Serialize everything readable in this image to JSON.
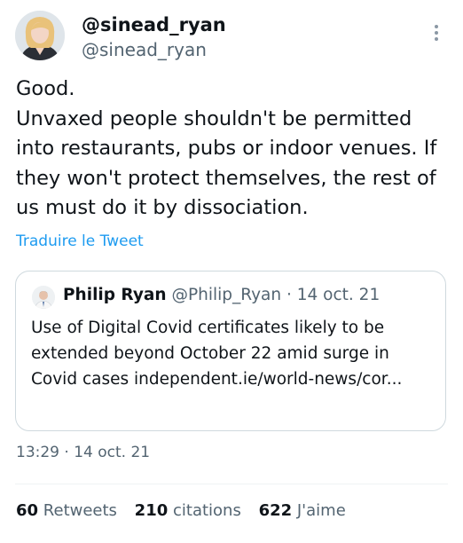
{
  "author": {
    "display_name": "@sinead_ryan",
    "handle": "@sinead_ryan"
  },
  "tweet": {
    "text": "Good.\nUnvaxed people shouldn't be permitted into restaurants, pubs or indoor venues. If they won't protect themselves, the rest of us must do it by dissociation.",
    "translate_label": "Traduire le Tweet",
    "timestamp": "13:29 · 14 oct. 21"
  },
  "quote": {
    "name": "Philip Ryan",
    "meta": "@Philip_Ryan · 14 oct. 21",
    "text": "Use of Digital Covid certificates likely to be extended beyond October 22 amid surge in Covid cases independent.ie/world-news/cor..."
  },
  "stats": {
    "retweets_count": "60",
    "retweets_label": "Retweets",
    "quotes_count": "210",
    "quotes_label": "citations",
    "likes_count": "622",
    "likes_label": "J'aime"
  },
  "colors": {
    "accent": "#1d9bf0",
    "secondary_text": "#536471",
    "border": "#cfd9de"
  },
  "icons": {
    "more": "more-vertical-icon"
  }
}
